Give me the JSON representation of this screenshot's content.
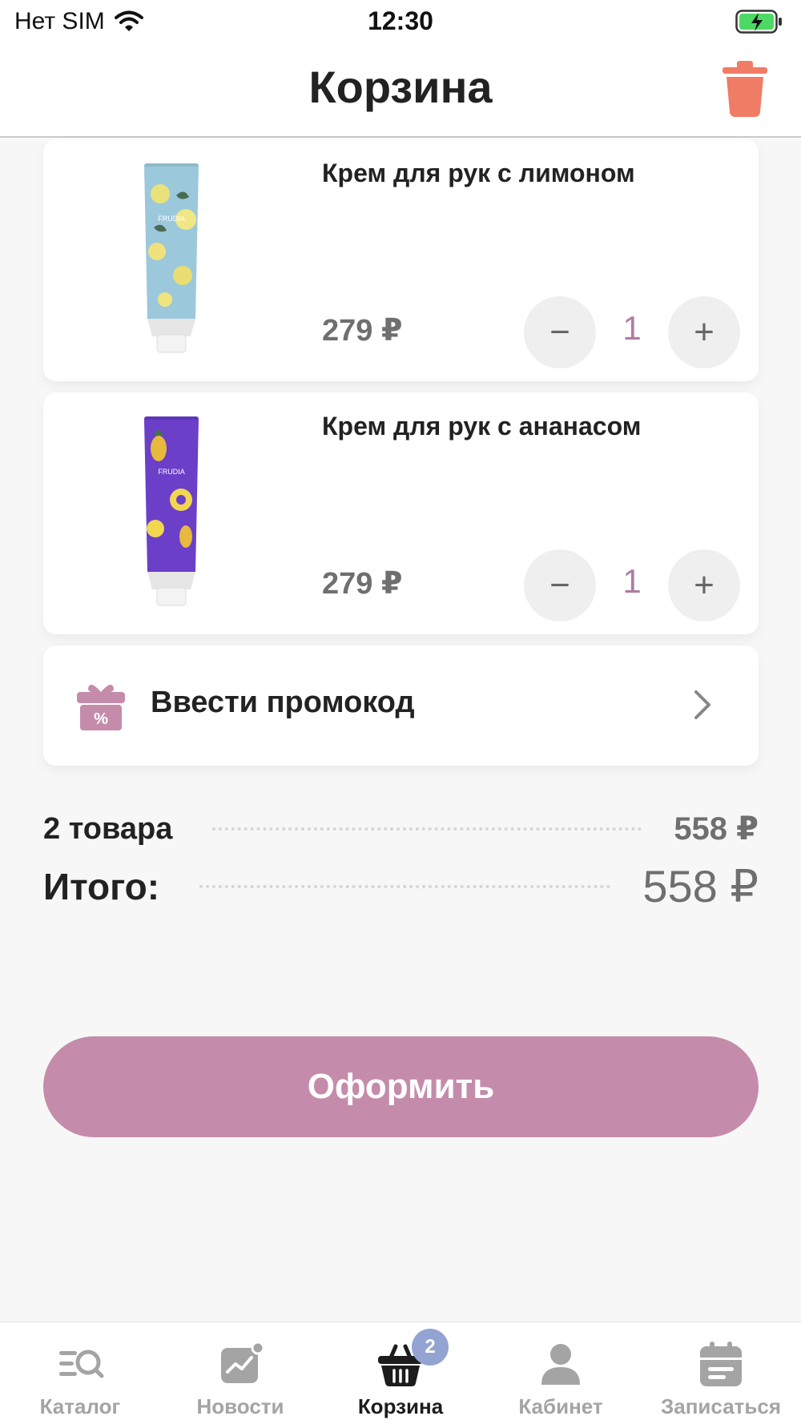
{
  "status_bar": {
    "carrier": "Нет SIM",
    "time": "12:30",
    "wifi_icon": "wifi-icon",
    "battery_icon": "battery-charging-icon"
  },
  "header": {
    "title": "Корзина",
    "trash_icon": "trash-icon",
    "trash_color": "#f07c66"
  },
  "cart": {
    "items": [
      {
        "name": "Крем для рук с лимоном",
        "price": "279 ₽",
        "quantity": "1",
        "image_icon": "lemon-hand-cream-image",
        "minus": "−",
        "plus": "+"
      },
      {
        "name": "Крем для рук с ананасом",
        "price": "279 ₽",
        "quantity": "1",
        "image_icon": "pineapple-hand-cream-image",
        "minus": "−",
        "plus": "+"
      }
    ]
  },
  "promo": {
    "label": "Ввести промокод",
    "icon": "gift-percent-icon"
  },
  "summary": {
    "items_label": "2 товара",
    "items_value": "558 ₽",
    "total_label": "Итого:",
    "total_value": "558 ₽"
  },
  "checkout": {
    "label": "Оформить",
    "color": "#c48caa"
  },
  "tab_bar": {
    "tabs": [
      {
        "label": "Каталог",
        "icon": "catalog-search-icon"
      },
      {
        "label": "Новости",
        "icon": "news-chart-icon"
      },
      {
        "label": "Корзина",
        "icon": "basket-icon",
        "badge": "2",
        "active": true
      },
      {
        "label": "Кабинет",
        "icon": "user-icon"
      },
      {
        "label": "Записаться",
        "icon": "calendar-icon"
      }
    ]
  },
  "colors": {
    "accent": "#c48caa",
    "quantity_text": "#b07ca0",
    "badge": "#93a4d2"
  }
}
